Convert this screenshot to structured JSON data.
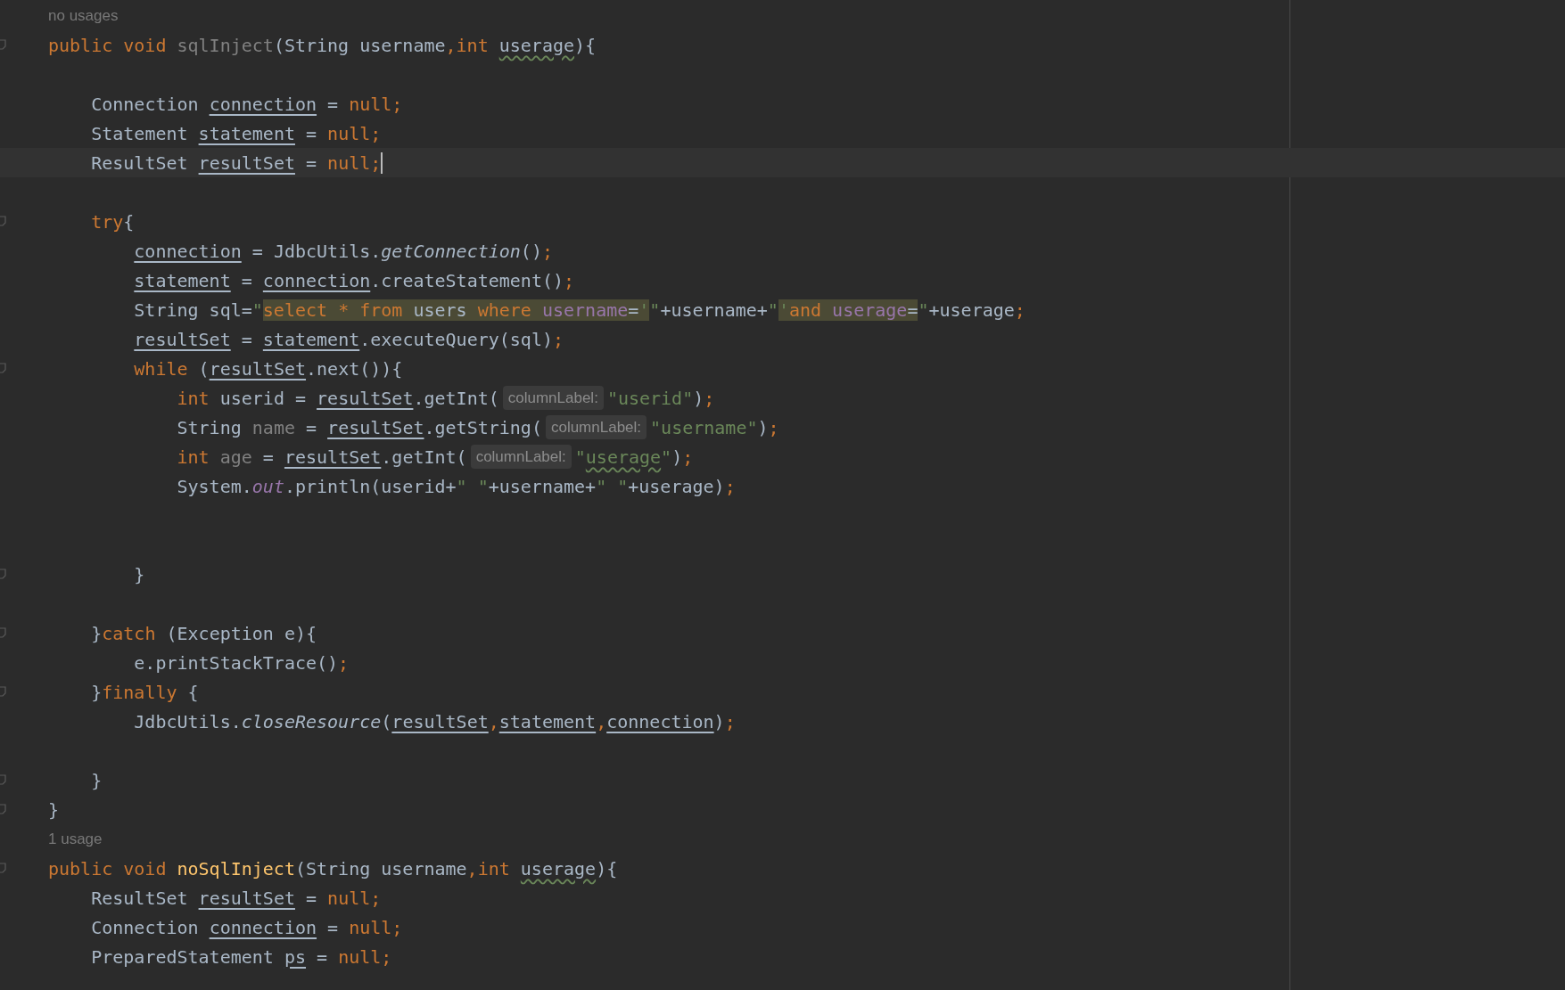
{
  "editor": {
    "lines": [
      {
        "kind": "usage",
        "text": "no usages"
      },
      {
        "kind": "code",
        "fold": true,
        "tokens": [
          {
            "kind": "keyword",
            "text": "public void "
          },
          {
            "kind": "unused",
            "text": "sqlInject"
          },
          {
            "kind": "plain",
            "text": "(String username"
          },
          {
            "kind": "keyword",
            "text": ",int "
          },
          {
            "kind": "warning",
            "text": "userage"
          },
          {
            "kind": "plain",
            "text": "){"
          }
        ]
      },
      {
        "kind": "blank"
      },
      {
        "kind": "code",
        "tokens": [
          {
            "kind": "plain",
            "text": "    Connection "
          },
          {
            "kind": "variable",
            "text": "connection"
          },
          {
            "kind": "plain",
            "text": " = "
          },
          {
            "kind": "keyword",
            "text": "null;"
          }
        ]
      },
      {
        "kind": "code",
        "tokens": [
          {
            "kind": "plain",
            "text": "    Statement "
          },
          {
            "kind": "variable",
            "text": "statement"
          },
          {
            "kind": "plain",
            "text": " = "
          },
          {
            "kind": "keyword",
            "text": "null;"
          }
        ]
      },
      {
        "kind": "code",
        "current": true,
        "caret": true,
        "tokens": [
          {
            "kind": "plain",
            "text": "    ResultSet "
          },
          {
            "kind": "variable",
            "text": "resultSet"
          },
          {
            "kind": "plain",
            "text": " = "
          },
          {
            "kind": "keyword",
            "text": "null;"
          }
        ]
      },
      {
        "kind": "blank"
      },
      {
        "kind": "code",
        "fold": true,
        "tokens": [
          {
            "kind": "keyword",
            "text": "    try"
          },
          {
            "kind": "plain",
            "text": "{"
          }
        ]
      },
      {
        "kind": "code",
        "tokens": [
          {
            "kind": "variable",
            "text": "        connection"
          },
          {
            "kind": "plain",
            "text": " = JdbcUtils."
          },
          {
            "kind": "static",
            "text": "getConnection"
          },
          {
            "kind": "plain",
            "text": "()"
          },
          {
            "kind": "keyword",
            "text": ";"
          }
        ]
      },
      {
        "kind": "code",
        "tokens": [
          {
            "kind": "variable",
            "text": "        statement"
          },
          {
            "kind": "plain",
            "text": " = "
          },
          {
            "kind": "variable",
            "text": "connection"
          },
          {
            "kind": "plain",
            "text": ".createStatement()"
          },
          {
            "kind": "keyword",
            "text": ";"
          }
        ]
      },
      {
        "kind": "code",
        "tokens": [
          {
            "kind": "plain",
            "text": "        String sql="
          },
          {
            "kind": "string",
            "text": "\""
          },
          {
            "kind": "sql_keyword",
            "text": "select "
          },
          {
            "kind": "sql_keyword",
            "text": "* "
          },
          {
            "kind": "sql_keyword",
            "text": "from "
          },
          {
            "kind": "sql_text",
            "text": "users "
          },
          {
            "kind": "sql_keyword",
            "text": "where "
          },
          {
            "kind": "sql_column",
            "text": "username"
          },
          {
            "kind": "sql_text",
            "text": "="
          },
          {
            "kind": "sql_string",
            "text": "'"
          },
          {
            "kind": "string",
            "text": "\""
          },
          {
            "kind": "plain",
            "text": "+username+"
          },
          {
            "kind": "string",
            "text": "\""
          },
          {
            "kind": "sql_string",
            "text": "'"
          },
          {
            "kind": "sql_keyword",
            "text": "and "
          },
          {
            "kind": "sql_column",
            "text": "userage"
          },
          {
            "kind": "sql_text",
            "text": "="
          },
          {
            "kind": "string",
            "text": "\""
          },
          {
            "kind": "plain",
            "text": "+userage"
          },
          {
            "kind": "keyword",
            "text": ";"
          }
        ]
      },
      {
        "kind": "code",
        "tokens": [
          {
            "kind": "variable",
            "text": "        resultSet"
          },
          {
            "kind": "plain",
            "text": " = "
          },
          {
            "kind": "variable",
            "text": "statement"
          },
          {
            "kind": "plain",
            "text": ".executeQuery(sql)"
          },
          {
            "kind": "keyword",
            "text": ";"
          }
        ]
      },
      {
        "kind": "code",
        "fold": true,
        "tokens": [
          {
            "kind": "keyword",
            "text": "        while"
          },
          {
            "kind": "plain",
            "text": " ("
          },
          {
            "kind": "variable",
            "text": "resultSet"
          },
          {
            "kind": "plain",
            "text": ".next()){"
          }
        ]
      },
      {
        "kind": "code",
        "tokens": [
          {
            "kind": "keyword",
            "text": "            int"
          },
          {
            "kind": "plain",
            "text": " userid = "
          },
          {
            "kind": "variable",
            "text": "resultSet"
          },
          {
            "kind": "plain",
            "text": ".getInt("
          },
          {
            "kind": "hint",
            "text": "columnLabel:"
          },
          {
            "kind": "string",
            "text": "\"userid\""
          },
          {
            "kind": "plain",
            "text": ")"
          },
          {
            "kind": "keyword",
            "text": ";"
          }
        ]
      },
      {
        "kind": "code",
        "tokens": [
          {
            "kind": "plain",
            "text": "            String "
          },
          {
            "kind": "unused",
            "text": "name"
          },
          {
            "kind": "plain",
            "text": " = "
          },
          {
            "kind": "variable",
            "text": "resultSet"
          },
          {
            "kind": "plain",
            "text": ".getString("
          },
          {
            "kind": "hint",
            "text": "columnLabel:"
          },
          {
            "kind": "string",
            "text": "\"username\""
          },
          {
            "kind": "plain",
            "text": ")"
          },
          {
            "kind": "keyword",
            "text": ";"
          }
        ]
      },
      {
        "kind": "code",
        "tokens": [
          {
            "kind": "keyword",
            "text": "            int "
          },
          {
            "kind": "unused",
            "text": "age"
          },
          {
            "kind": "plain",
            "text": " = "
          },
          {
            "kind": "variable",
            "text": "resultSet"
          },
          {
            "kind": "plain",
            "text": ".getInt("
          },
          {
            "kind": "hint",
            "text": "columnLabel:"
          },
          {
            "kind": "string",
            "text": "\""
          },
          {
            "kind": "string_warning",
            "text": "userage"
          },
          {
            "kind": "string",
            "text": "\""
          },
          {
            "kind": "plain",
            "text": ")"
          },
          {
            "kind": "keyword",
            "text": ";"
          }
        ]
      },
      {
        "kind": "code",
        "tokens": [
          {
            "kind": "plain",
            "text": "            System."
          },
          {
            "kind": "field",
            "text": "out"
          },
          {
            "kind": "plain",
            "text": ".println(userid+"
          },
          {
            "kind": "string",
            "text": "\" \""
          },
          {
            "kind": "plain",
            "text": "+username+"
          },
          {
            "kind": "string",
            "text": "\" \""
          },
          {
            "kind": "plain",
            "text": "+userage)"
          },
          {
            "kind": "keyword",
            "text": ";"
          }
        ]
      },
      {
        "kind": "blank"
      },
      {
        "kind": "blank"
      },
      {
        "kind": "code",
        "fold": true,
        "tokens": [
          {
            "kind": "plain",
            "text": "        }"
          }
        ]
      },
      {
        "kind": "blank"
      },
      {
        "kind": "code",
        "fold": true,
        "tokens": [
          {
            "kind": "plain",
            "text": "    }"
          },
          {
            "kind": "keyword",
            "text": "catch"
          },
          {
            "kind": "plain",
            "text": " (Exception e){"
          }
        ]
      },
      {
        "kind": "code",
        "tokens": [
          {
            "kind": "plain",
            "text": "        e.printStackTrace()"
          },
          {
            "kind": "keyword",
            "text": ";"
          }
        ]
      },
      {
        "kind": "code",
        "fold": true,
        "tokens": [
          {
            "kind": "plain",
            "text": "    }"
          },
          {
            "kind": "keyword",
            "text": "finally"
          },
          {
            "kind": "plain",
            "text": " {"
          }
        ]
      },
      {
        "kind": "code",
        "tokens": [
          {
            "kind": "plain",
            "text": "        JdbcUtils."
          },
          {
            "kind": "static",
            "text": "closeResource"
          },
          {
            "kind": "plain",
            "text": "("
          },
          {
            "kind": "variable",
            "text": "resultSet"
          },
          {
            "kind": "keyword",
            "text": ","
          },
          {
            "kind": "variable",
            "text": "statement"
          },
          {
            "kind": "keyword",
            "text": ","
          },
          {
            "kind": "variable",
            "text": "connection"
          },
          {
            "kind": "plain",
            "text": ")"
          },
          {
            "kind": "keyword",
            "text": ";"
          }
        ]
      },
      {
        "kind": "blank"
      },
      {
        "kind": "code",
        "fold": true,
        "tokens": [
          {
            "kind": "plain",
            "text": "    }"
          }
        ]
      },
      {
        "kind": "code",
        "fold": true,
        "tokens": [
          {
            "kind": "plain",
            "text": "}"
          }
        ]
      },
      {
        "kind": "usage",
        "text": "1 usage"
      },
      {
        "kind": "code",
        "fold": true,
        "tokens": [
          {
            "kind": "keyword",
            "text": "public void "
          },
          {
            "kind": "declaration",
            "text": "noSqlInject"
          },
          {
            "kind": "plain",
            "text": "(String username"
          },
          {
            "kind": "keyword",
            "text": ",int "
          },
          {
            "kind": "warning",
            "text": "userage"
          },
          {
            "kind": "plain",
            "text": "){"
          }
        ]
      },
      {
        "kind": "code",
        "tokens": [
          {
            "kind": "plain",
            "text": "    ResultSet "
          },
          {
            "kind": "variable",
            "text": "resultSet"
          },
          {
            "kind": "plain",
            "text": " = "
          },
          {
            "kind": "keyword",
            "text": "null;"
          }
        ]
      },
      {
        "kind": "code",
        "tokens": [
          {
            "kind": "plain",
            "text": "    Connection "
          },
          {
            "kind": "variable",
            "text": "connection"
          },
          {
            "kind": "plain",
            "text": " = "
          },
          {
            "kind": "keyword",
            "text": "null;"
          }
        ]
      },
      {
        "kind": "code",
        "tokens": [
          {
            "kind": "plain",
            "text": "    PreparedStatement "
          },
          {
            "kind": "variable",
            "text": "ps"
          },
          {
            "kind": "plain",
            "text": " = "
          },
          {
            "kind": "keyword",
            "text": "null;"
          }
        ]
      }
    ]
  }
}
